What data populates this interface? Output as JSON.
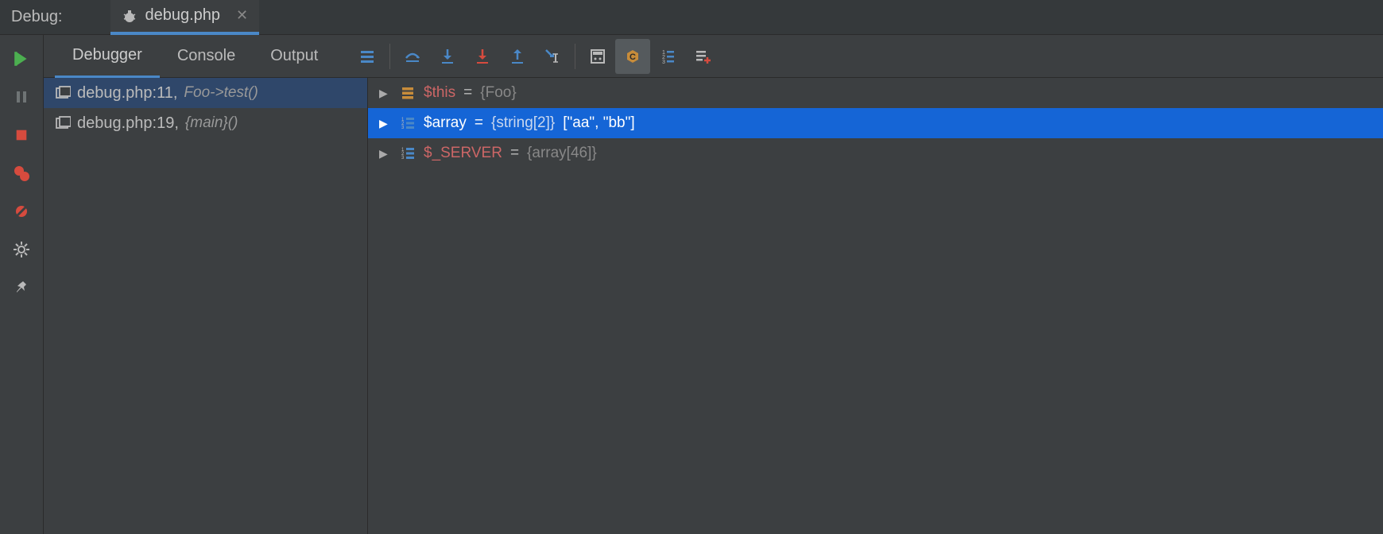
{
  "header": {
    "title": "Debug:",
    "tab_label": "debug.php"
  },
  "toolbar": {
    "tabs": [
      "Debugger",
      "Console",
      "Output"
    ]
  },
  "frames": [
    {
      "file": "debug.php",
      "line": 11,
      "func": "Foo->test()",
      "selected": true
    },
    {
      "file": "debug.php",
      "line": 19,
      "func": "{main}()",
      "selected": false
    }
  ],
  "variables": [
    {
      "name": "$this",
      "type": "{Foo}",
      "value": "",
      "icon": "obj",
      "selected": false
    },
    {
      "name": "$array",
      "type": "{string[2]}",
      "value": "[\"aa\", \"bb\"]",
      "icon": "arr",
      "selected": true
    },
    {
      "name": "$_SERVER",
      "type": "{array[46]}",
      "value": "",
      "icon": "arr",
      "selected": false
    }
  ]
}
